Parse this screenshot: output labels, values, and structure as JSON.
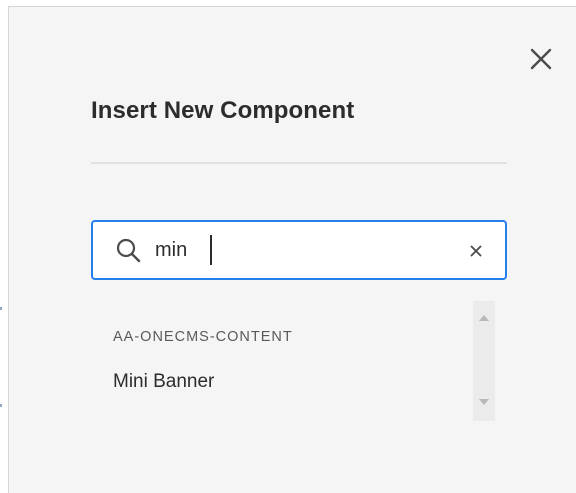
{
  "dialog": {
    "title": "Insert New Component",
    "close_icon": "close-icon"
  },
  "search": {
    "value": "min",
    "icon": "search-icon",
    "clear_icon": "clear-icon",
    "accent_color": "#2680eb"
  },
  "results": {
    "groups": [
      {
        "heading": "AA-ONECMS-CONTENT",
        "items": [
          {
            "label": "Mini Banner"
          }
        ]
      }
    ],
    "scroll_up_icon": "caret-up-icon",
    "scroll_down_icon": "caret-down-icon"
  }
}
